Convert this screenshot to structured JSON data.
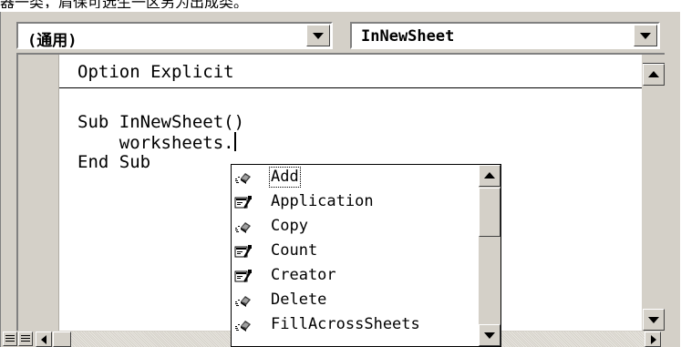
{
  "caption": "器一类，肩保可选生一区另为出成类。",
  "object_combo": {
    "value": "(通用)"
  },
  "proc_combo": {
    "value": "InNewSheet"
  },
  "code": {
    "line1": "Option Explicit",
    "line2": "Sub InNewSheet()",
    "line3": "    worksheets.",
    "line4": "End Sub"
  },
  "autocomplete": {
    "items": [
      {
        "label": "Add",
        "icon": "method-icon"
      },
      {
        "label": "Application",
        "icon": "property-icon"
      },
      {
        "label": "Copy",
        "icon": "method-icon"
      },
      {
        "label": "Count",
        "icon": "property-icon"
      },
      {
        "label": "Creator",
        "icon": "property-icon"
      },
      {
        "label": "Delete",
        "icon": "method-icon"
      },
      {
        "label": "FillAcrossSheets",
        "icon": "method-icon"
      }
    ],
    "selected_index": 0
  }
}
